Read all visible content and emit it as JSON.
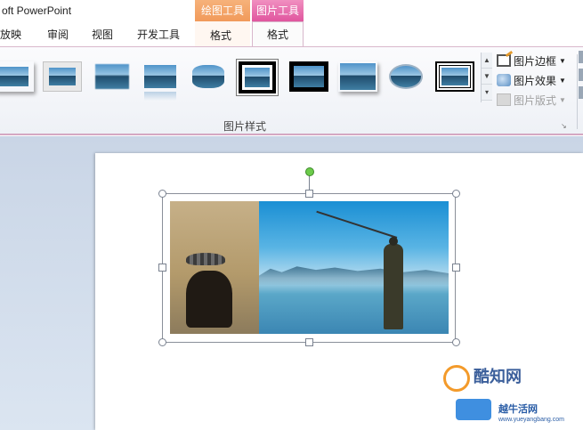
{
  "app": {
    "title": "oft PowerPoint"
  },
  "contextual_groups": {
    "drawing_tools": "绘图工具",
    "picture_tools": "图片工具"
  },
  "tabs": [
    {
      "label": "放映"
    },
    {
      "label": "审阅"
    },
    {
      "label": "视图"
    },
    {
      "label": "开发工具"
    },
    {
      "label": "格式"
    },
    {
      "label": "格式"
    }
  ],
  "ribbon": {
    "group_label": "图片样式",
    "commands": {
      "picture_border": "图片边框",
      "picture_effects": "图片效果",
      "picture_layout": "图片版式"
    },
    "picture_styles": [
      "thumb-simple",
      "thumb-shadow-rect",
      "thumb-soft-edge",
      "thumb-reflect",
      "thumb-soft-oval",
      "thumb-thick-black",
      "thumb-black-frame",
      "thumb-drop-shadow",
      "thumb-oval",
      "thumb-double-frame"
    ]
  },
  "watermark": {
    "line1": "酷知网",
    "line2": "越牛活网",
    "url": "www.yueyangbang.com"
  },
  "colors": {
    "drawing_tools": "#f19a5a",
    "picture_tools": "#e0559e",
    "rotate_handle": "#6ccb4a"
  }
}
